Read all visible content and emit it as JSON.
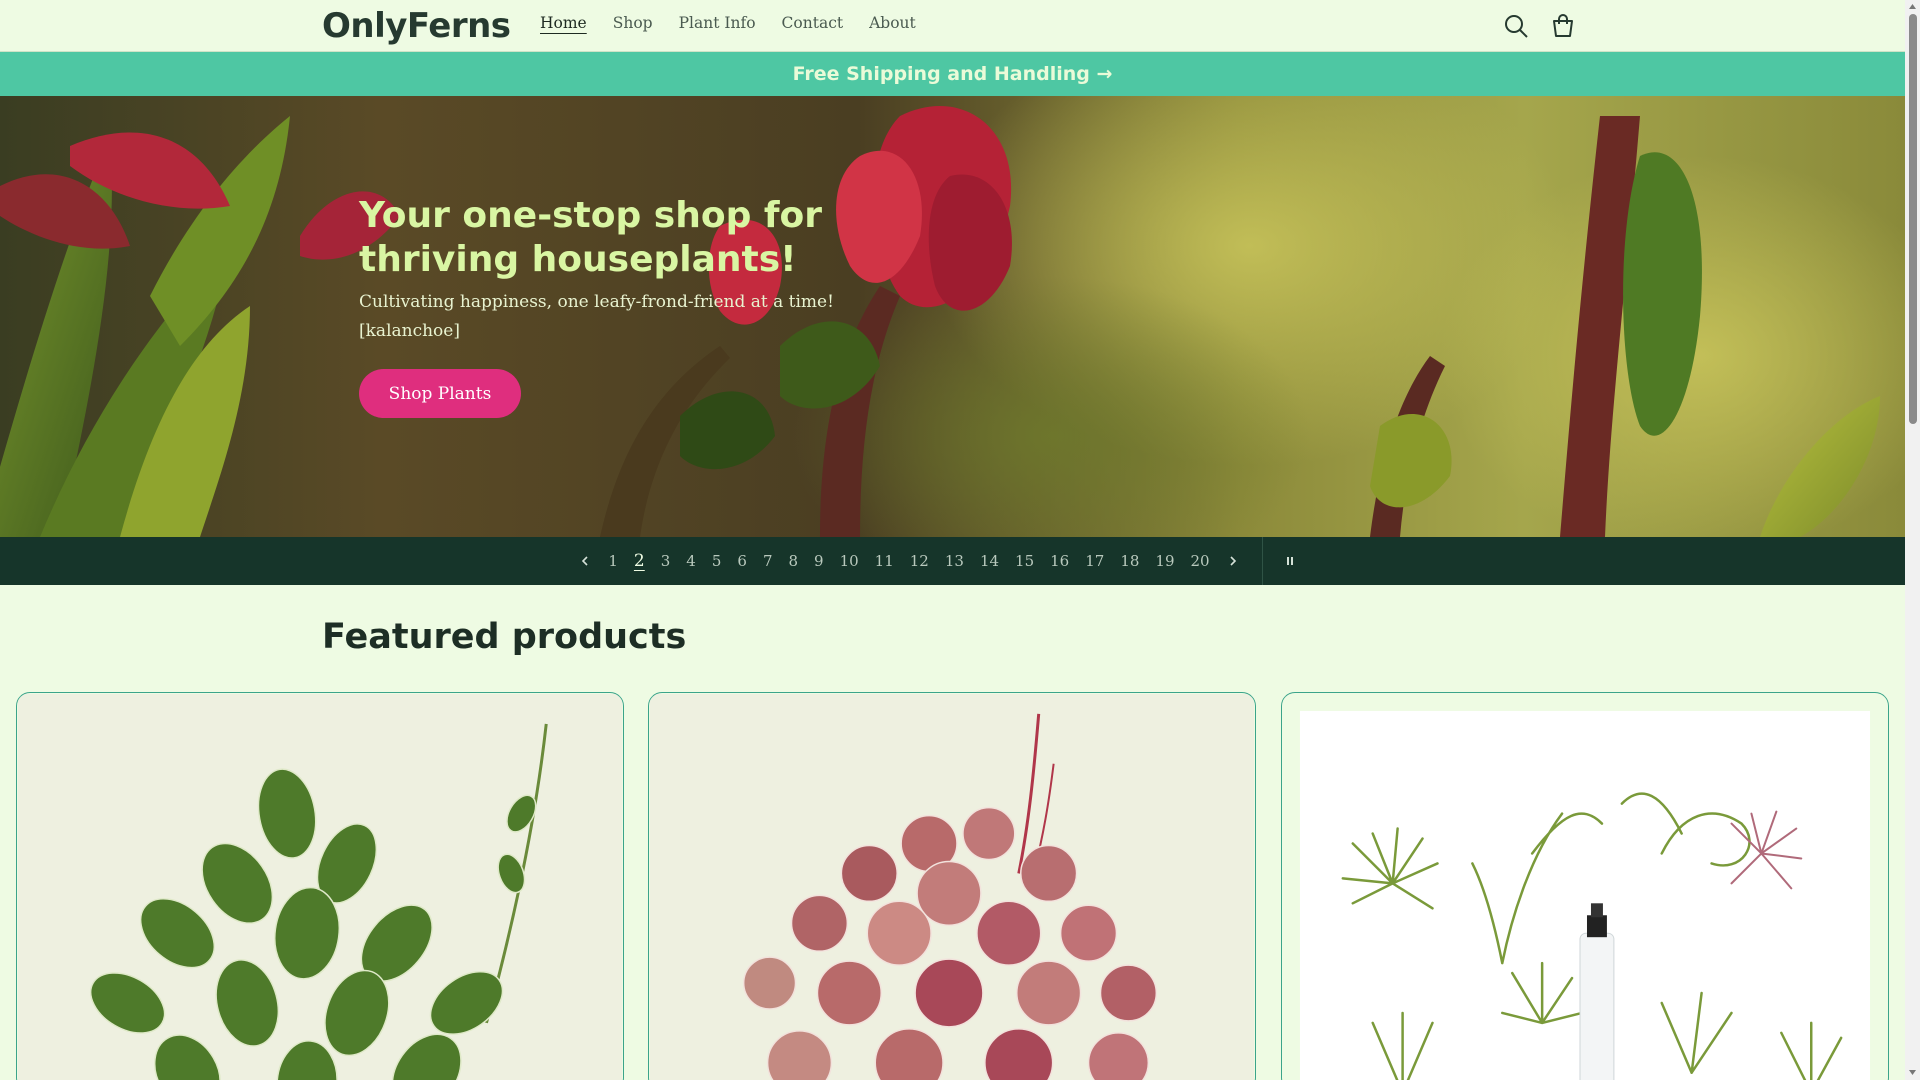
{
  "brand": {
    "logo": "OnlyFerns"
  },
  "nav": {
    "items": [
      {
        "label": "Home",
        "active": true
      },
      {
        "label": "Shop"
      },
      {
        "label": "Plant Info"
      },
      {
        "label": "Contact"
      },
      {
        "label": "About"
      }
    ],
    "icons": [
      "search-icon",
      "cart-icon"
    ]
  },
  "announcement": {
    "text": "Free Shipping and Handling →"
  },
  "hero": {
    "title": "Your one-stop shop for thriving houseplants!",
    "subtitle": "Cultivating happiness, one leafy-frond-friend at a time! [kalanchoe]",
    "button": "Shop Plants"
  },
  "slider": {
    "current": "2",
    "slides": [
      "1",
      "2",
      "3",
      "4",
      "5",
      "6",
      "7",
      "8",
      "9",
      "10",
      "11",
      "12",
      "13",
      "14",
      "15",
      "16",
      "17",
      "18",
      "19",
      "20"
    ],
    "icons": [
      "chevron-left-icon",
      "chevron-right-icon",
      "pause-icon"
    ]
  },
  "featured": {
    "title": "Featured products",
    "products": [
      {
        "image": "fittonia-plant"
      },
      {
        "image": "peperomia-plant"
      },
      {
        "image": "air-plants-set"
      }
    ]
  },
  "colors": {
    "background": "#eefbe3",
    "announcement": "#4ec7a3",
    "accent": "#df2e7e",
    "slider_bar": "#16352a",
    "card_border": "#3ba48a",
    "hero_title": "#d9f6a3"
  }
}
